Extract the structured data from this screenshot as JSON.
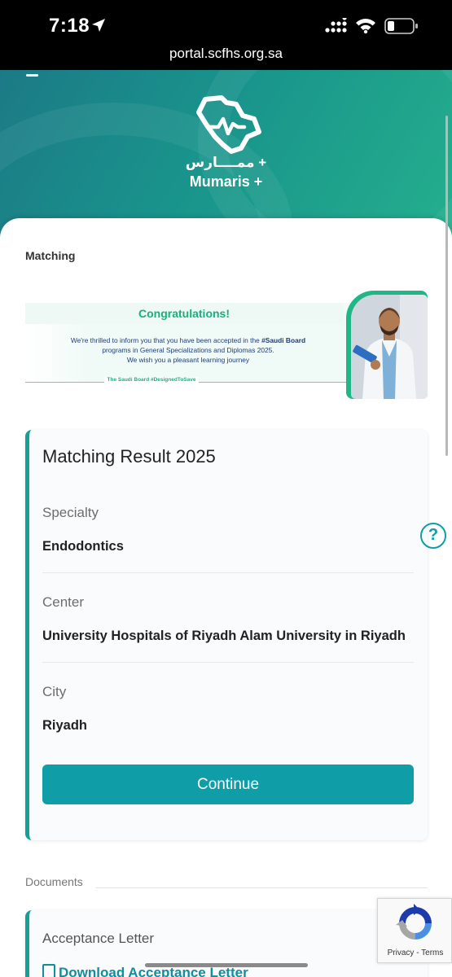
{
  "status_bar": {
    "time": "7:18",
    "url": "portal.scfhs.org.sa"
  },
  "header": {
    "logo_arabic": "ممــــارس +",
    "logo_english": "Mumaris +"
  },
  "page": {
    "section_title": "Matching"
  },
  "banner": {
    "title": "Congratulations!",
    "line1_pre": "We're thrilled to inform you that you have been accepted in the ",
    "line1_bold": "#Saudi Board",
    "line2": "programs in General Specializations and Diplomas 2025.",
    "line3": "We wish you a pleasant learning journey",
    "tagline": "The Saudi Board #DesignedToSave"
  },
  "result": {
    "title": "Matching Result 2025",
    "specialty_label": "Specialty",
    "specialty_value": "Endodontics",
    "center_label": "Center",
    "center_value": "University Hospitals of Riyadh Alam University in Riyadh",
    "city_label": "City",
    "city_value": "Riyadh",
    "continue_label": "Continue"
  },
  "documents": {
    "label": "Documents",
    "card_title": "Acceptance Letter",
    "download_label": "Download Acceptance Letter"
  },
  "help": {
    "glyph": "?"
  },
  "recaptcha": {
    "text": "Privacy - Terms"
  },
  "colors": {
    "accent": "#0f9ea8",
    "success": "#17b17a",
    "hero_start": "#1c7a86",
    "hero_end": "#25b08d"
  }
}
